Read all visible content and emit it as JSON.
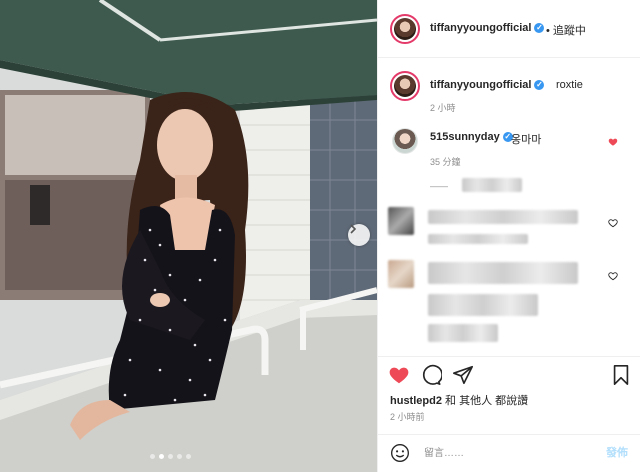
{
  "header": {
    "username": "tiffanyyoung​official",
    "follow_label": "• 追蹤中",
    "verified_icon": "verified-badge-icon"
  },
  "caption": {
    "username": "tiffanyyoungofficial",
    "text": "roxtie",
    "time": "2 小時"
  },
  "comments": [
    {
      "username": "515sunnyday",
      "text": "옹마마",
      "time": "35 分鐘",
      "liked": true,
      "reply_prefix": "——"
    }
  ],
  "likes": {
    "user": "hustlepd2",
    "rest": "和 其他人 都說讚",
    "time": "2 小時前"
  },
  "comment_box": {
    "placeholder": "留言……",
    "post_label": "發佈"
  },
  "colors": {
    "verified": "#3897f0",
    "heart": "#ed4956",
    "story_ring": "#e43a6a",
    "awning": "#3e5a4e"
  },
  "carousel": {
    "count": 5,
    "active": 1
  }
}
